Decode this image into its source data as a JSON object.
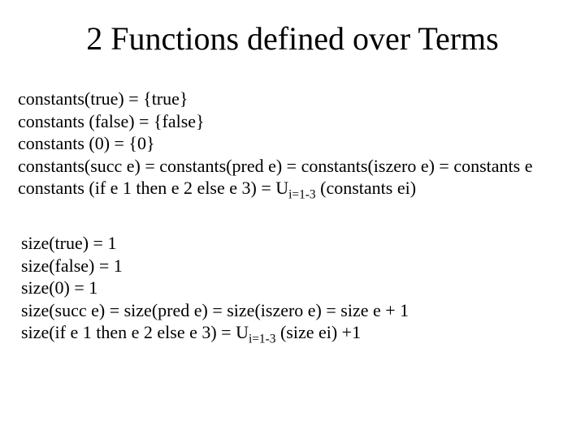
{
  "title": "2 Functions defined over Terms",
  "constants": {
    "l1": "constants(true) = {true}",
    "l2": "constants (false) = {false}",
    "l3": "constants (0) = {0}",
    "l4": "constants(succ e) = constants(pred e) = constants(iszero e) = constants e",
    "l5a": "constants (if e 1 then e 2 else e 3) = U",
    "l5_sub": "i=1-3",
    "l5b": " (constants ei)"
  },
  "size": {
    "l1": "size(true) = 1",
    "l2": "size(false) = 1",
    "l3": "size(0) = 1",
    "l4": "size(succ e) = size(pred e) = size(iszero e) = size e + 1",
    "l5a": "size(if e 1 then e 2 else e 3) = U",
    "l5_sub": "i=1-3",
    "l5b": " (size ei) +1"
  }
}
